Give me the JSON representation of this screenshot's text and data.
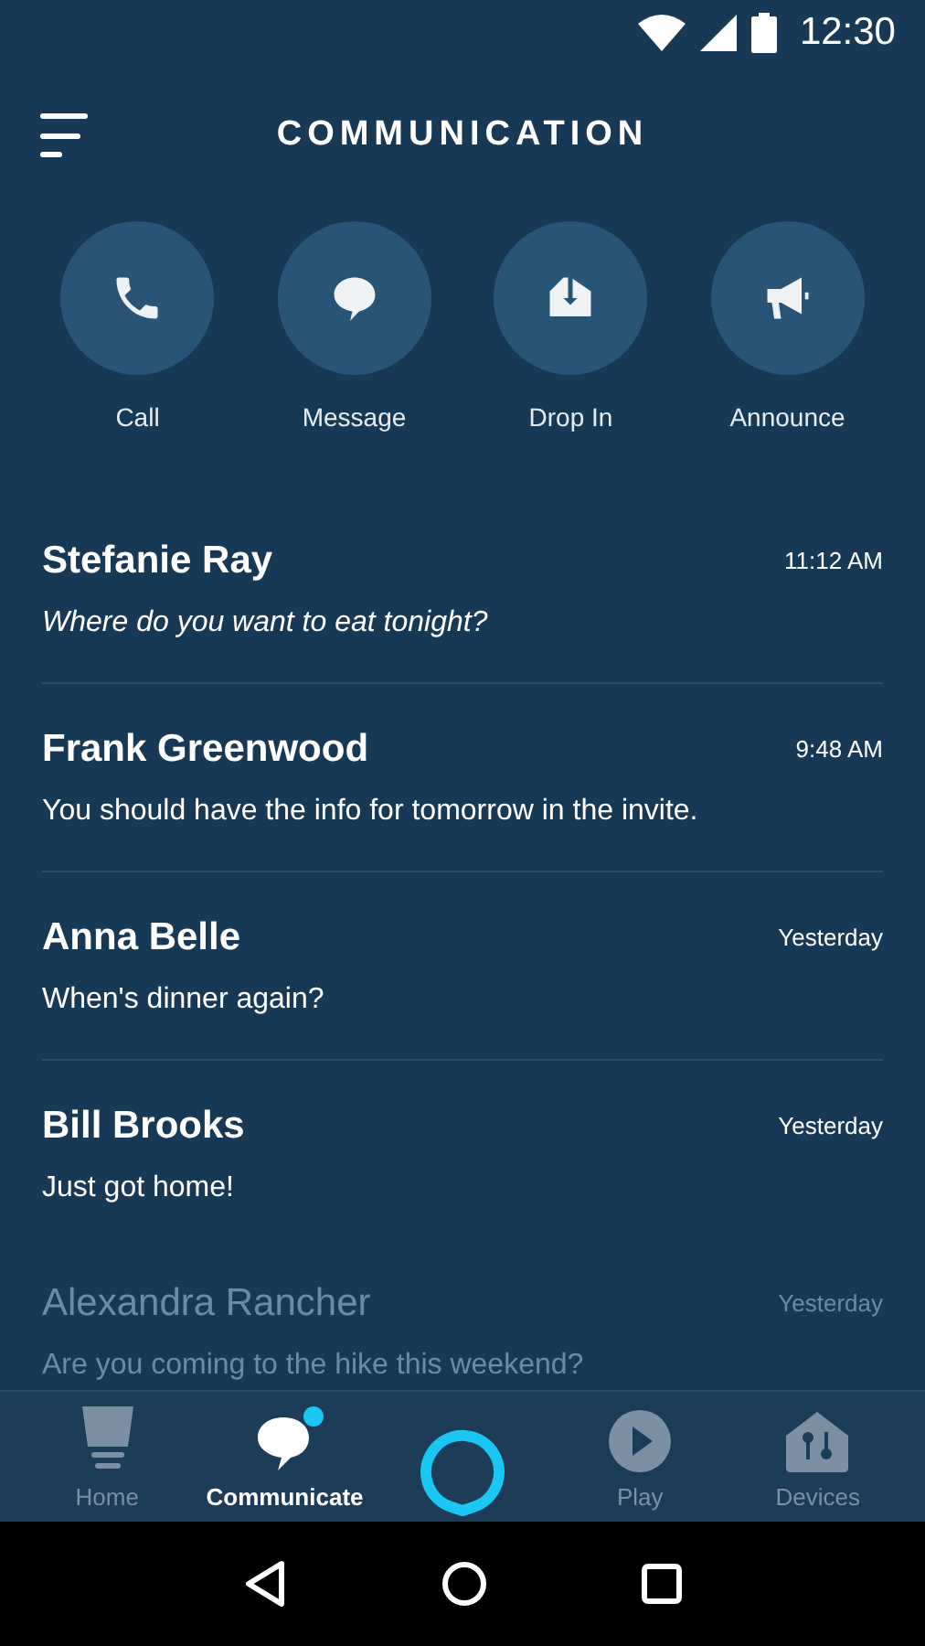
{
  "status_bar": {
    "time": "12:30"
  },
  "header": {
    "title": "COMMUNICATION"
  },
  "actions": [
    {
      "label": "Call",
      "kind": "call"
    },
    {
      "label": "Message",
      "kind": "message"
    },
    {
      "label": "Drop In",
      "kind": "dropin"
    },
    {
      "label": "Announce",
      "kind": "announce"
    }
  ],
  "conversations": [
    {
      "name": "Stefanie Ray",
      "time": "11:12 AM",
      "preview": "Where do you want to eat tonight?",
      "italic": true,
      "faded": false
    },
    {
      "name": "Frank Greenwood",
      "time": "9:48 AM",
      "preview": "You should have the info for tomorrow in the invite.",
      "italic": false,
      "faded": false
    },
    {
      "name": "Anna Belle",
      "time": "Yesterday",
      "preview": "When's dinner again?",
      "italic": false,
      "faded": false
    },
    {
      "name": "Bill Brooks",
      "time": "Yesterday",
      "preview": "Just got home!",
      "italic": false,
      "faded": false
    },
    {
      "name": "Alexandra Rancher",
      "time": "Yesterday",
      "preview": "Are you coming to the hike this weekend?",
      "italic": false,
      "faded": true
    }
  ],
  "bottom_nav": [
    {
      "label": "Home",
      "kind": "home",
      "selected": false,
      "badge": false
    },
    {
      "label": "Communicate",
      "kind": "communicate",
      "selected": true,
      "badge": true
    },
    {
      "kind": "alexa",
      "selected": false,
      "badge": false
    },
    {
      "label": "Play",
      "kind": "play",
      "selected": false,
      "badge": false
    },
    {
      "label": "Devices",
      "kind": "devices",
      "selected": false,
      "badge": false
    }
  ]
}
